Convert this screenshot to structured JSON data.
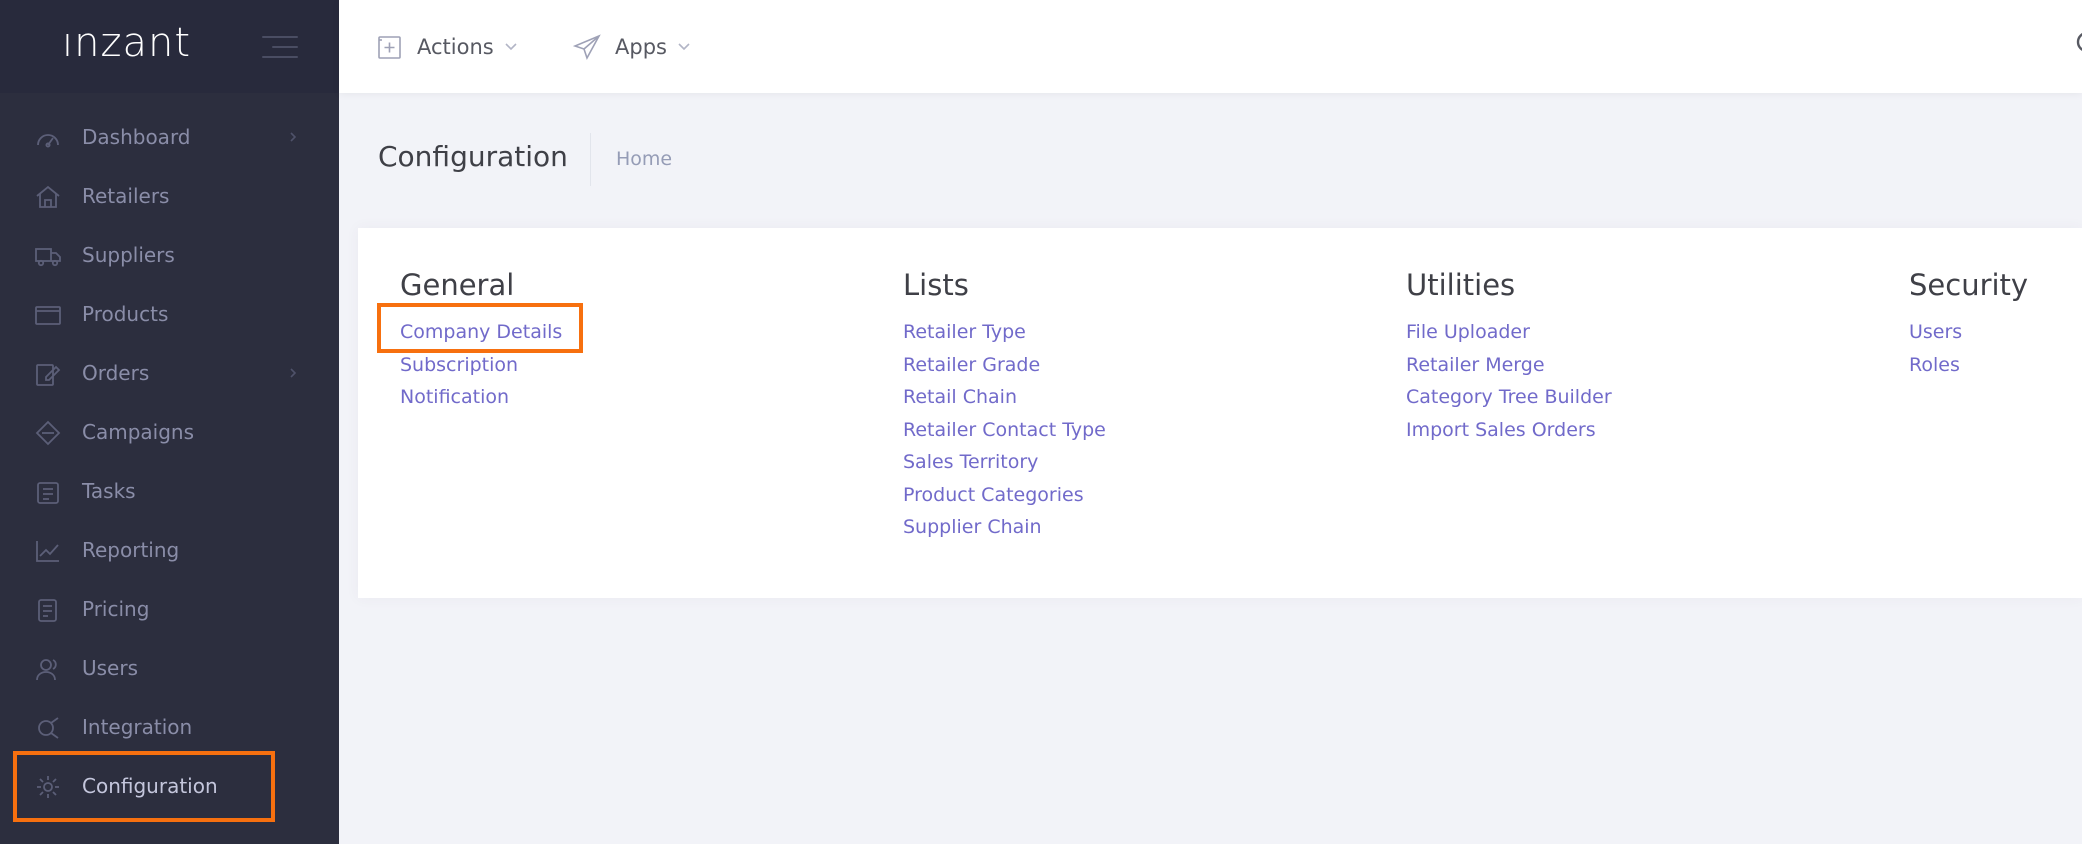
{
  "app": {
    "brand": "ınzant"
  },
  "sidebar": {
    "items": [
      {
        "label": "Dashboard",
        "icon": "dashboard-icon",
        "has_submenu": true
      },
      {
        "label": "Retailers",
        "icon": "home-icon",
        "has_submenu": false
      },
      {
        "label": "Suppliers",
        "icon": "truck-icon",
        "has_submenu": false
      },
      {
        "label": "Products",
        "icon": "box-icon",
        "has_submenu": false
      },
      {
        "label": "Orders",
        "icon": "edit-icon",
        "has_submenu": true
      },
      {
        "label": "Campaigns",
        "icon": "diamond-icon",
        "has_submenu": false
      },
      {
        "label": "Tasks",
        "icon": "clipboard-icon",
        "has_submenu": false
      },
      {
        "label": "Reporting",
        "icon": "chart-line-icon",
        "has_submenu": false
      },
      {
        "label": "Pricing",
        "icon": "price-tag-icon",
        "has_submenu": false
      },
      {
        "label": "Users",
        "icon": "users-icon",
        "has_submenu": false
      },
      {
        "label": "Integration",
        "icon": "plug-icon",
        "has_submenu": false
      },
      {
        "label": "Configuration",
        "icon": "gear-icon",
        "has_submenu": false
      }
    ]
  },
  "header": {
    "actions_label": "Actions",
    "apps_label": "Apps"
  },
  "subheader": {
    "title": "Configuration",
    "breadcrumb": "Home"
  },
  "sections": [
    {
      "title": "General",
      "links": [
        "Company Details",
        "Subscription",
        "Notification"
      ]
    },
    {
      "title": "Lists",
      "links": [
        "Retailer Type",
        "Retailer Grade",
        "Retail Chain",
        "Retailer Contact Type",
        "Sales Territory",
        "Product Categories",
        "Supplier Chain"
      ]
    },
    {
      "title": "Utilities",
      "links": [
        "File Uploader",
        "Retailer Merge",
        "Category Tree Builder",
        "Import Sales Orders"
      ]
    },
    {
      "title": "Security",
      "links": [
        "Users",
        "Roles"
      ]
    }
  ],
  "colors": {
    "sidebar_bg": "#2c2e3e",
    "link": "#716aca",
    "highlight": "#f7700f",
    "page_bg": "#f2f3f8"
  }
}
